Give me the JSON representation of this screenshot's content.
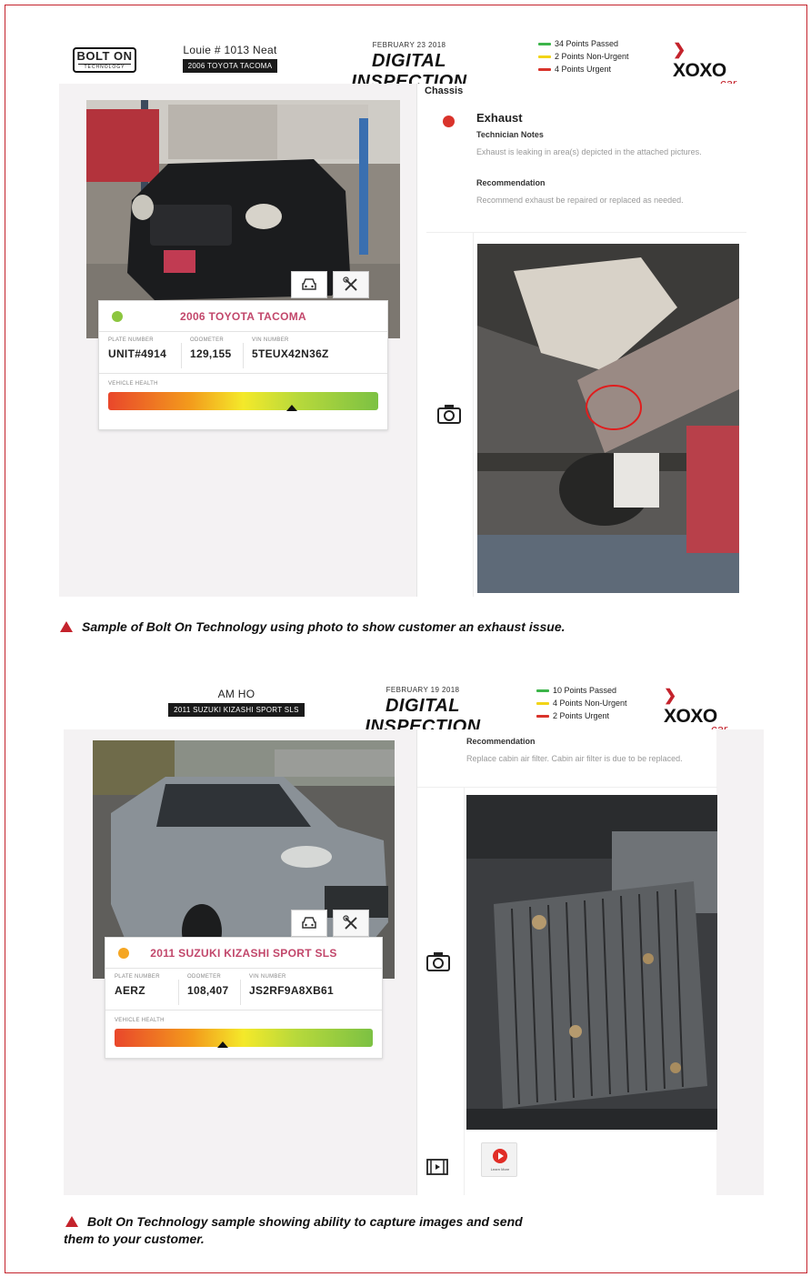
{
  "colors": {
    "border_red": "#c4232c",
    "passed_green": "#3cb54a",
    "non_urgent_yellow": "#f2d416",
    "urgent_red": "#d9332b",
    "car_name_pink": "#c2476b"
  },
  "sample1": {
    "header": {
      "logo_line1": "BOLT ON",
      "logo_line2": "TECHNOLOGY",
      "customer_name": "Louie # 1013 Neat",
      "vehicle_tag": "2006 TOYOTA TACOMA",
      "date": "FEBRUARY 23 2018",
      "title": "DIGITAL INSPECTION",
      "legend": [
        {
          "label": "34 Points Passed",
          "color": "#3cb54a"
        },
        {
          "label": "2 Points Non-Urgent",
          "color": "#f2d416"
        },
        {
          "label": "4 Points Urgent",
          "color": "#d9332b"
        }
      ],
      "brand": "XOXO",
      "brand_sub": "car"
    },
    "vehicle_card": {
      "status_dot_color": "#8cc63f",
      "name": "2006 TOYOTA TACOMA",
      "plate_label": "PLATE NUMBER",
      "plate": "UNIT#4914",
      "odometer_label": "ODOMETER",
      "odometer": "129,155",
      "vin_label": "VIN NUMBER",
      "vin": "5TEUX42N36Z",
      "health_label": "VEHICLE HEALTH",
      "health_level": 0.68
    },
    "inspection": {
      "section": "Chassis",
      "status_color": "#d9332b",
      "item": "Exhaust",
      "notes_label": "Technician Notes",
      "notes": "Exhaust is leaking in area(s) depicted in the attached pictures.",
      "rec_label": "Recommendation",
      "recommendation": "Recommend exhaust be repaired or replaced as needed."
    },
    "caption": "Sample of Bolt On Technology using photo to show customer an exhaust issue."
  },
  "sample2": {
    "header": {
      "customer_name": "AM  HO",
      "vehicle_tag": "2011 SUZUKI KIZASHI SPORT SLS",
      "date": "FEBRUARY 19 2018",
      "title": "DIGITAL INSPECTION",
      "legend": [
        {
          "label": "10 Points Passed",
          "color": "#3cb54a"
        },
        {
          "label": "4 Points Non-Urgent",
          "color": "#f2d416"
        },
        {
          "label": "2 Points Urgent",
          "color": "#d9332b"
        }
      ],
      "brand": "XOXO",
      "brand_sub": "car"
    },
    "vehicle_card": {
      "status_dot_color": "#f5a623",
      "name": "2011 SUZUKI KIZASHI SPORT SLS",
      "plate_label": "PLATE NUMBER",
      "plate": "AERZ",
      "odometer_label": "ODOMETER",
      "odometer": "108,407",
      "vin_label": "VIN NUMBER",
      "vin": "JS2RF9A8XB61",
      "health_label": "VEHICLE HEALTH",
      "health_level": 0.42
    },
    "inspection": {
      "rec_label": "Recommendation",
      "recommendation": "Replace cabin air filter. Cabin air filter is due to be replaced.",
      "video_label": "Learn More"
    },
    "caption_line1": "Bolt On Technology sample showing ability to capture images and send",
    "caption_line2": "them to your customer."
  }
}
